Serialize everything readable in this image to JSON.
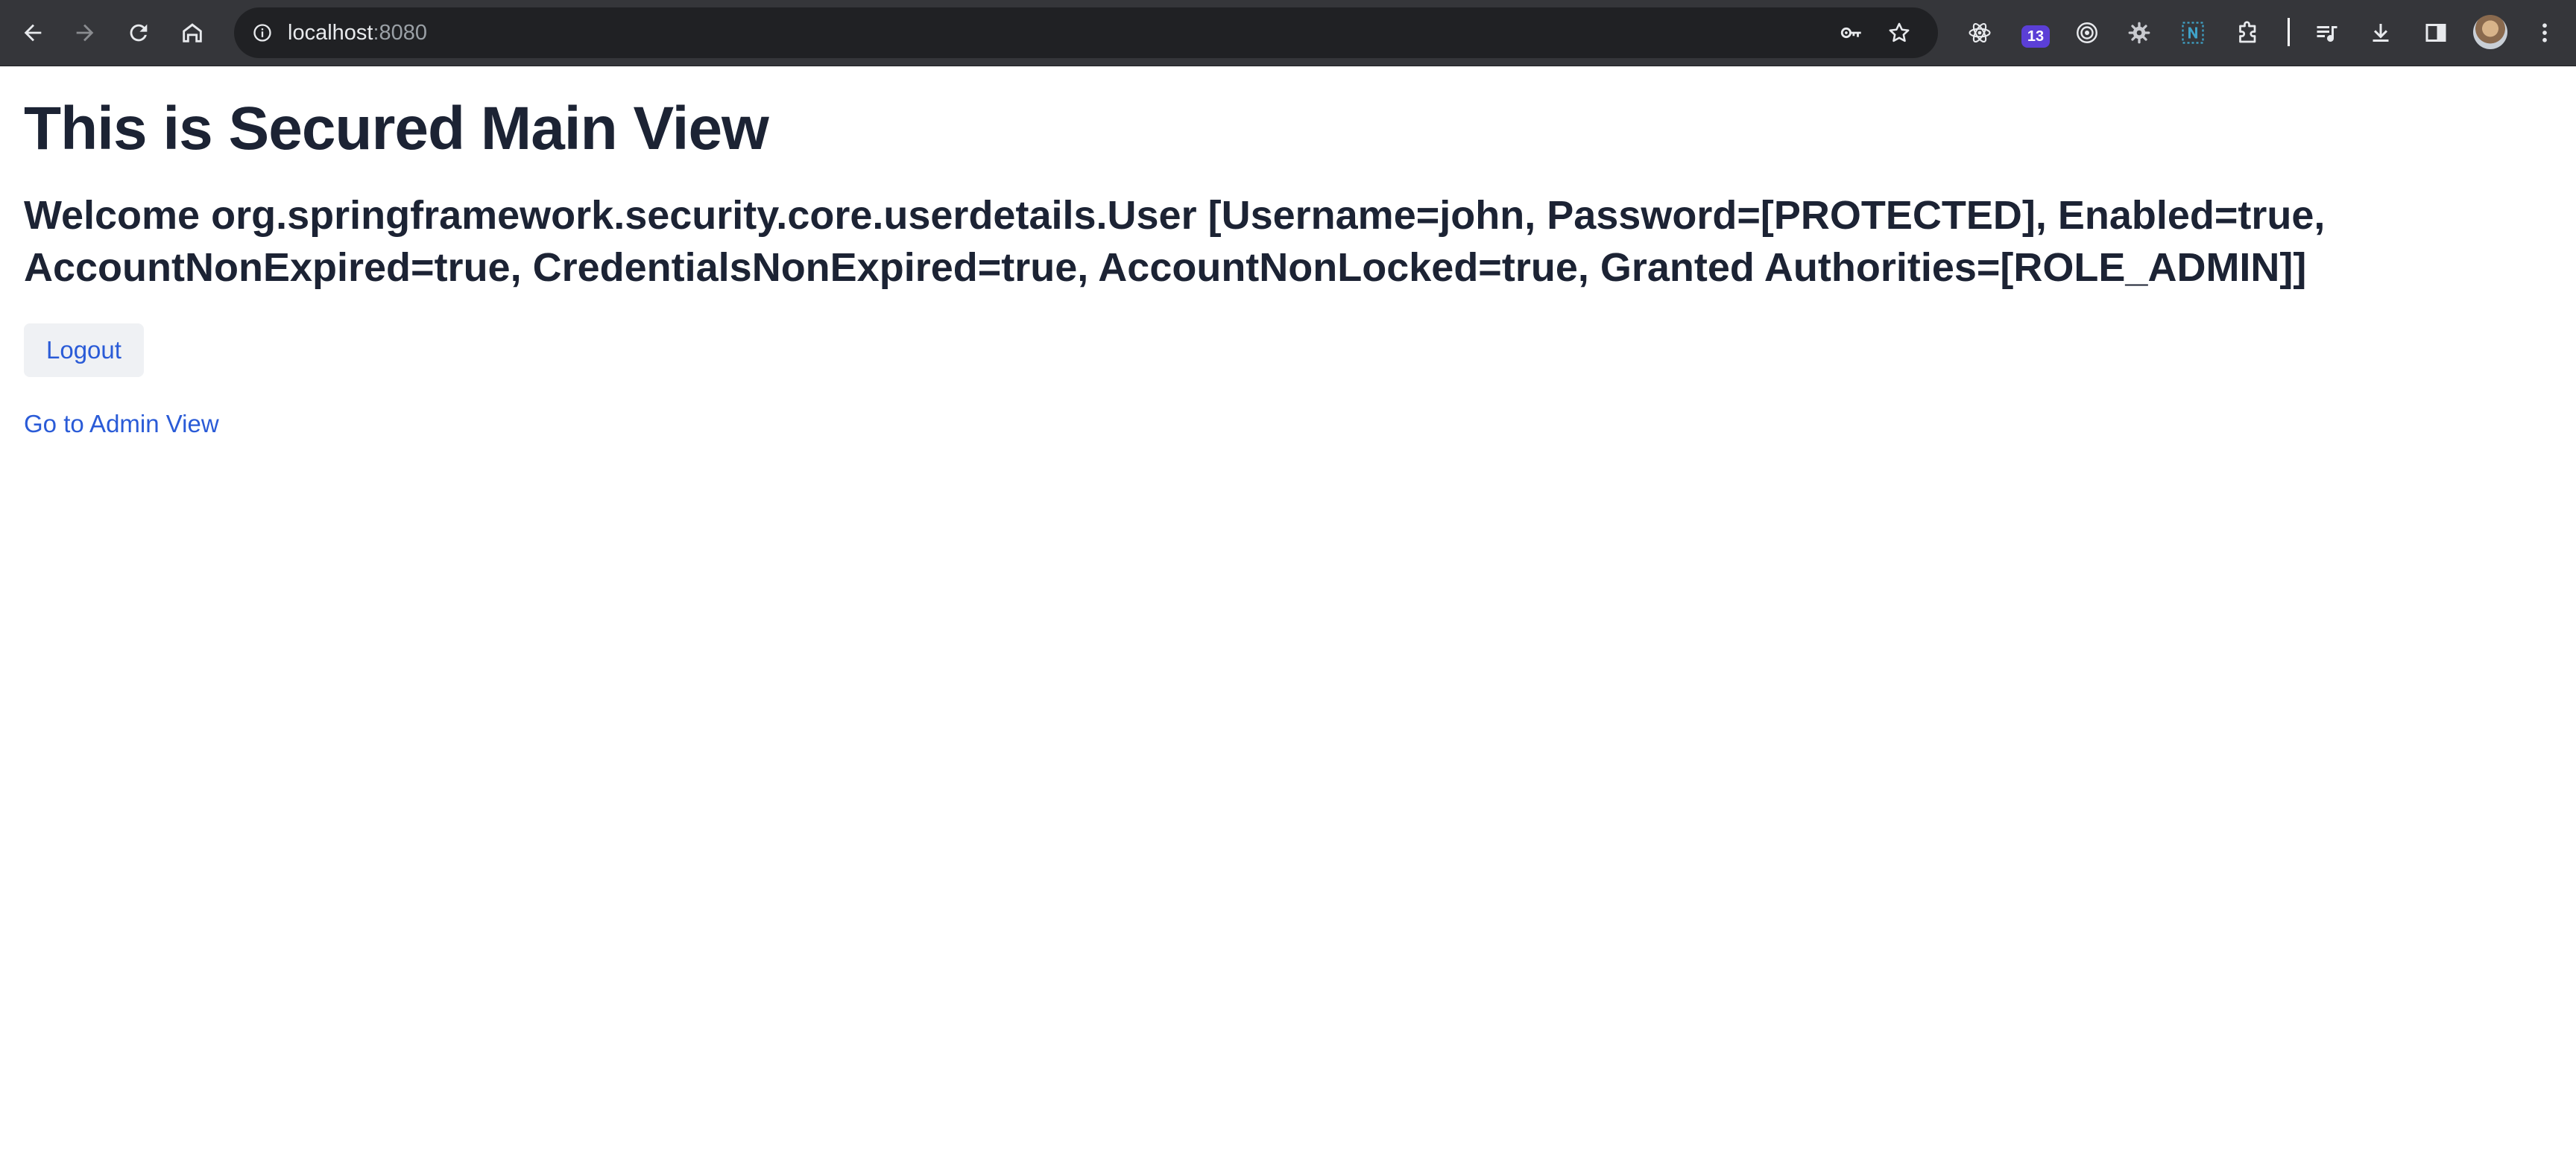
{
  "browser": {
    "url_host": "localhost",
    "url_port": ":8080",
    "extension_badge_count": "13",
    "icons": {
      "back": "arrow-left-icon",
      "forward": "arrow-right-icon",
      "reload": "reload-icon",
      "home": "home-icon",
      "site_info": "info-icon",
      "passwords": "key-icon",
      "bookmark": "star-icon",
      "extensions": [
        "react-devtools-icon",
        "hat-extension-icon",
        "target-extension-icon",
        "gear-extension-icon",
        "n-extension-icon"
      ],
      "extensions_menu": "puzzle-icon",
      "media": "playlist-icon",
      "downloads": "download-icon",
      "side_panel": "side-panel-icon",
      "profile": "avatar",
      "menu": "kebab-menu-icon"
    },
    "colors": {
      "toolbar_bg": "#35363a",
      "omnibox_bg": "#202124",
      "badge_bg": "#5b3fd6"
    }
  },
  "page": {
    "title": "This is Secured Main View",
    "welcome_text": "Welcome org.springframework.security.core.userdetails.User [Username=john, Password=[PROTECTED], Enabled=true, AccountNonExpired=true, CredentialsNonExpired=true, AccountNonLocked=true, Granted Authorities=[ROLE_ADMIN]]",
    "logout_label": "Logout",
    "admin_link_label": "Go to Admin View",
    "colors": {
      "heading": "#1c2334",
      "link": "#2a5bd7",
      "button_bg": "#eff1f4"
    }
  }
}
